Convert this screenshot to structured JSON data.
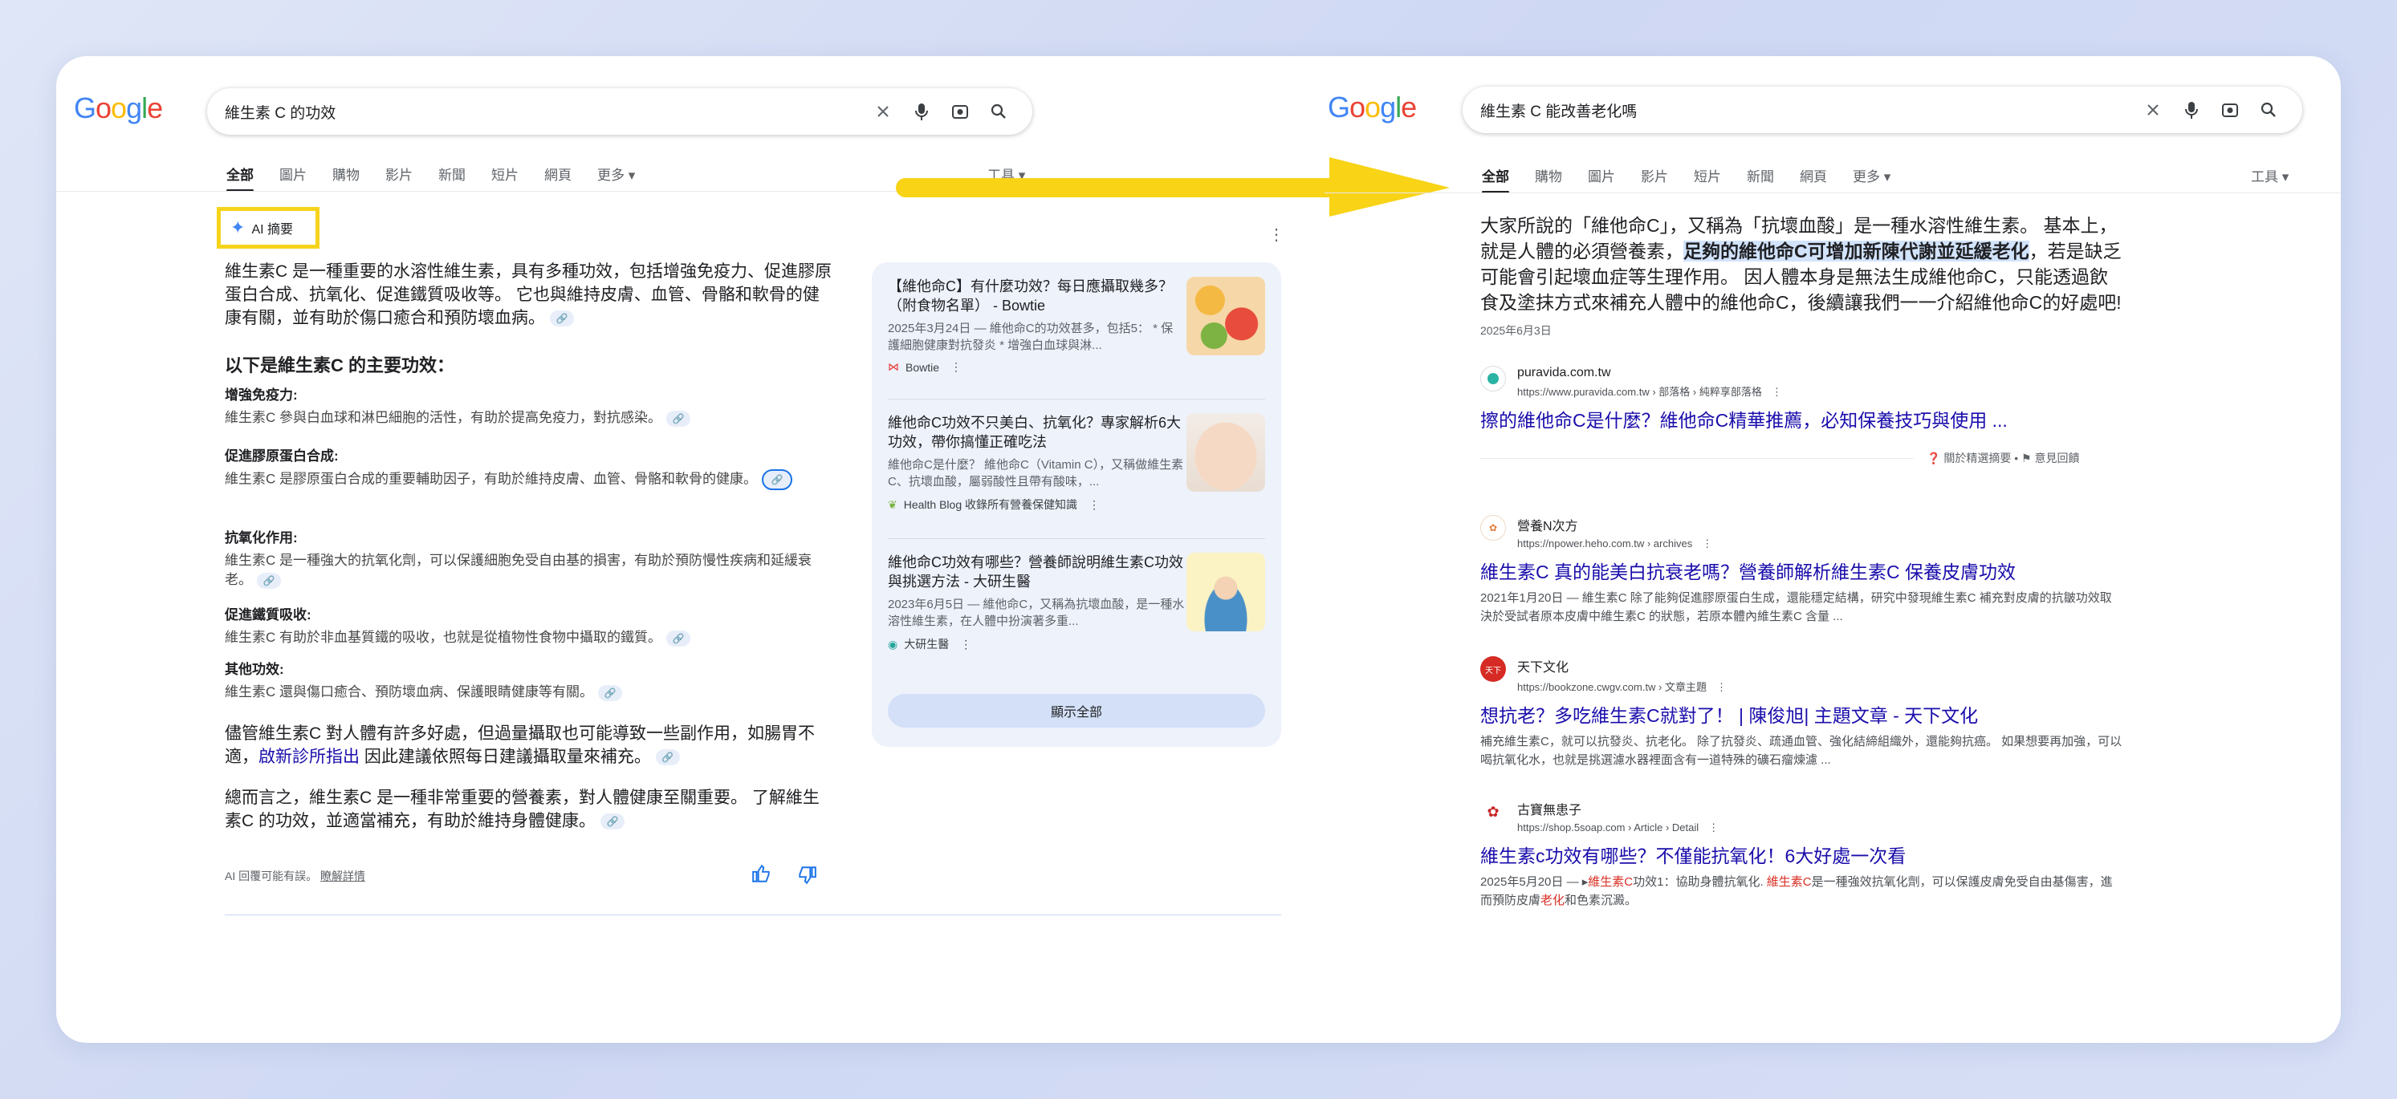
{
  "left": {
    "query": "維生素 C 的功效",
    "tabs": [
      "全部",
      "圖片",
      "購物",
      "影片",
      "新聞",
      "短片",
      "網頁",
      "更多 ▾"
    ],
    "tools": "工具 ▾",
    "ai_label": "AI 摘要",
    "intro": "維生素C 是一種重要的水溶性維生素，具有多種功效，包括增強免疫力、促進膠原蛋白合成、抗氧化、促進鐵質吸收等。 它也與維持皮膚、血管、骨骼和軟骨的健康有關，並有助於傷口癒合和預防壞血病。",
    "heading": "以下是維生素C 的主要功效：",
    "benefits": [
      {
        "title": "增強免疫力:",
        "desc": "維生素C 參與白血球和淋巴細胞的活性，有助於提高免疫力，對抗感染。"
      },
      {
        "title": "促進膠原蛋白合成:",
        "desc": "維生素C 是膠原蛋白合成的重要輔助因子，有助於維持皮膚、血管、骨骼和軟骨的健康。"
      },
      {
        "title": "抗氧化作用:",
        "desc": "維生素C 是一種強大的抗氧化劑，可以保護細胞免受自由基的損害，有助於預防慢性疾病和延緩衰老。"
      },
      {
        "title": "促進鐵質吸收:",
        "desc": "維生素C 有助於非血基質鐵的吸收，也就是從植物性食物中攝取的鐵質。"
      },
      {
        "title": "其他功效:",
        "desc": "維生素C 還與傷口癒合、預防壞血病、保護眼睛健康等有關。"
      }
    ],
    "warning_pre": "儘管維生素C 對人體有許多好處，但過量攝取也可能導致一些副作用，如腸胃不適，",
    "warning_link": "啟新診所指出",
    "warning_post": " 因此建議依照每日建議攝取量來補充。",
    "summary": "總而言之，維生素C 是一種非常重要的營養素，對人體健康至關重要。 了解維生素C 的功效，並適當補充，有助於維持身體健康。",
    "footer_note": "AI 回覆可能有誤。",
    "footer_link": "瞭解詳情",
    "sources": [
      {
        "title": "【維他命C】有什麼功效？每日應攝取幾多？（附食物名單） - Bowtie",
        "desc": "2025年3月24日 — 維他命C的功效甚多，包括5： * 保護細胞健康對抗發炎 * 增強白血球與淋...",
        "site": "Bowtie"
      },
      {
        "title": "維他命C功效不只美白、抗氧化？專家解析6大功效，帶你搞懂正確吃法",
        "desc": "維他命C是什麼？ 維他命C（Vitamin C），又稱做維生素C、抗壞血酸，屬弱酸性且帶有酸味，...",
        "site": "Health Blog 收錄所有營養保健知識"
      },
      {
        "title": "維他命C功效有哪些？營養師說明維生素C功效與挑選方法 - 大研生醫",
        "desc": "2023年6月5日 — 維他命C，又稱為抗壞血酸，是一種水溶性維生素，在人體中扮演著多重...",
        "site": "大研生醫"
      }
    ],
    "show_all": "顯示全部"
  },
  "right": {
    "query": "維生素 C 能改善老化嗎",
    "tabs": [
      "全部",
      "購物",
      "圖片",
      "影片",
      "短片",
      "新聞",
      "網頁",
      "更多 ▾"
    ],
    "tools": "工具 ▾",
    "snippet_pre": "大家所說的「維他命C」，又稱為「抗壞血酸」是一種水溶性維生素。 基本上，就是人體的必須營養素，",
    "snippet_mark": "足夠的維他命C可增加新陳代謝並延緩老化",
    "snippet_post": "，若是缺乏可能會引起壞血症等生理作用。 因人體本身是無法生成維他命C，只能透過飲食及塗抹方式來補充人體中的維他命C，後續讓我們一一介紹維他命C的好處吧!",
    "snippet_date": "2025年6月3日",
    "featured": {
      "site": "puravida.com.tw",
      "url": "https://www.puravida.com.tw › 部落格 › 純粹享部落格",
      "title": "擦的維他命C是什麼？維他命C精華推薦，必知保養技巧與使用 ..."
    },
    "feedback_about": "關於精選摘要",
    "feedback_send": "意見回饋",
    "results": [
      {
        "site": "營養N次方",
        "url": "https://npower.heho.com.tw › archives",
        "title": "維生素C 真的能美白抗衰老嗎？營養師解析維生素C 保養皮膚功效",
        "desc": "2021年1月20日 — 維生素C 除了能夠促進膠原蛋白生成，還能穩定結構，研究中發現維生素C 補充對皮膚的抗皺功效取決於受試者原本皮膚中維生素C 的狀態，若原本體內維生素C 含量 ..."
      },
      {
        "site": "天下文化",
        "url": "https://bookzone.cwgv.com.tw › 文章主題",
        "title": "想抗老？多吃維生素C就對了！ | 陳俊旭| 主題文章 - 天下文化",
        "desc": "補充維生素C，就可以抗發炎、抗老化。 除了抗發炎、疏通血管、強化結締組織外，還能夠抗癌。 如果想要再加強，可以喝抗氧化水，也就是挑選濾水器裡面含有一道特殊的礦石瘤煉濾 ..."
      },
      {
        "site": "古寶無患子",
        "url": "https://shop.5soap.com › Article › Detail",
        "title": "維生素c功效有哪些？不僅能抗氧化！6大好處一次看",
        "desc_date": "2025年5月20日 — ▸",
        "desc_r1": "維生素C",
        "desc_m1": "功效1：協助身體抗氧化. ",
        "desc_r2": "維生素C",
        "desc_m2": "是一種強效抗氧化劑，可以保護皮膚免受自由基傷害，進而預防皮膚",
        "desc_r3": "老化",
        "desc_m3": "和色素沉澱。"
      }
    ]
  },
  "colors": {
    "accent_yellow": "#f5d31b",
    "link_blue": "#1a0dab"
  }
}
